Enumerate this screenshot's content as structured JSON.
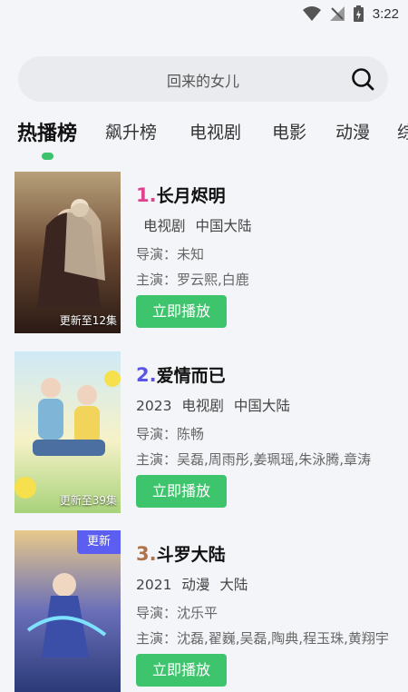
{
  "status_bar": {
    "time": "3:22"
  },
  "search": {
    "placeholder": "回来的女儿"
  },
  "tabs": [
    {
      "label": "热播榜",
      "active": true
    },
    {
      "label": "飙升榜"
    },
    {
      "label": "电视剧"
    },
    {
      "label": "电影"
    },
    {
      "label": "动漫"
    },
    {
      "label": "综"
    }
  ],
  "items": [
    {
      "rank": "1.",
      "rank_color": "#e0428d",
      "title": "长月烬明",
      "year": "",
      "type": "电视剧",
      "region": "中国大陆",
      "director": "导演：未知",
      "cast": "主演：罗云熙,白鹿",
      "play_label": "立即播放",
      "poster_caption": "更新至12集",
      "poster_art": "长月烬明"
    },
    {
      "rank": "2.",
      "rank_color": "#5b55e6",
      "title": "爱情而已",
      "year": "2023",
      "type": "电视剧",
      "region": "中国大陆",
      "director": "导演：陈畅",
      "cast": "主演：吴磊,周雨彤,姜珮瑶,朱泳腾,章涛",
      "play_label": "立即播放",
      "poster_caption": "更新至39集",
      "poster_art": "爱情而已"
    },
    {
      "rank": "3.",
      "rank_color": "#b0724a",
      "title": "斗罗大陆",
      "year": "2021",
      "type": "动漫",
      "region": "大陆",
      "director": "导演：沈乐平",
      "cast": "主演：沈磊,翟巍,吴磊,陶典,程玉珠,黄翔宇",
      "play_label": "立即播放",
      "badge": "更新",
      "poster_art": "斗罗大陆"
    }
  ]
}
